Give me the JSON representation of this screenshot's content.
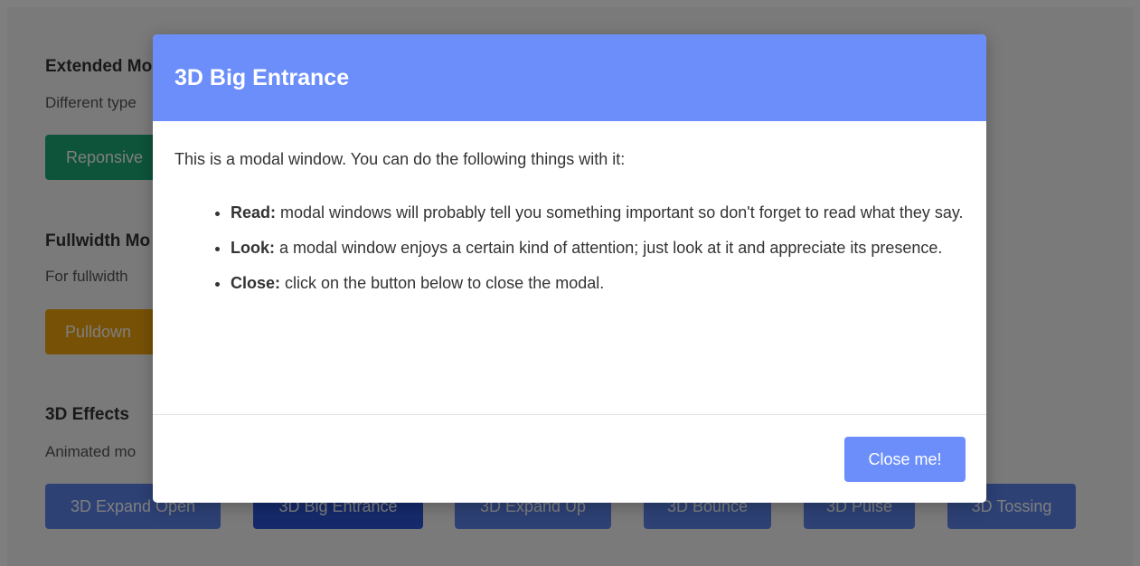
{
  "sections": {
    "extended": {
      "title": "Extended Mo",
      "desc": "Different type",
      "buttons": [
        "Reponsive"
      ]
    },
    "fullwidth": {
      "title": "Fullwidth Mo",
      "desc": "For fullwidth",
      "buttons": [
        "Pulldown"
      ]
    },
    "effects3d": {
      "title": "3D Effects",
      "desc": "Animated mo",
      "buttons": [
        "3D Expand Open",
        "3D Big Entrance",
        "3D Expand Up",
        "3D Bounce",
        "3D Pulse",
        "3D Tossing"
      ]
    }
  },
  "modal": {
    "title": "3D Big Entrance",
    "intro": "This is a modal window. You can do the following things with it:",
    "items": [
      {
        "label": "Read:",
        "text": "modal windows will probably tell you something important so don't forget to read what they say."
      },
      {
        "label": "Look:",
        "text": "a modal window enjoys a certain kind of attention; just look at it and appreciate its presence."
      },
      {
        "label": "Close:",
        "text": "click on the button below to close the modal."
      }
    ],
    "close_label": "Close me!"
  },
  "colors": {
    "modal_header": "#6b8efb",
    "green": "#1aa874",
    "orange": "#efa20a",
    "blue": "#5a83ea",
    "overlay": "rgba(0,0,0,0.5)"
  }
}
